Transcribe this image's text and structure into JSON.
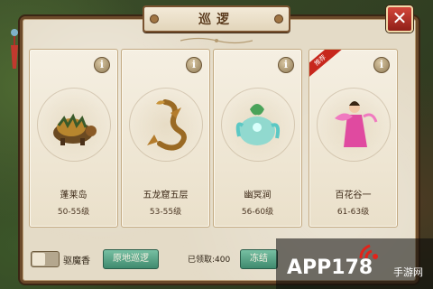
{
  "window": {
    "title": "巡逻",
    "close_label": "✕"
  },
  "cards": [
    {
      "name": "蓬莱岛",
      "level": "50-55级",
      "info_label": "i",
      "creature_icon": "turtle-beast-icon"
    },
    {
      "name": "五龙窟五层",
      "level": "53-55级",
      "info_label": "i",
      "creature_icon": "golden-dragon-icon"
    },
    {
      "name": "幽冥涧",
      "level": "56-60级",
      "info_label": "i",
      "creature_icon": "ghost-beast-icon"
    },
    {
      "name": "百花谷一",
      "level": "61-63级",
      "info_label": "i",
      "creature_icon": "flower-fairy-icon",
      "recommended": true,
      "ribbon_label": "推荐"
    }
  ],
  "bottom": {
    "toggle_label": "驱魔香",
    "patrol_button": "原地巡逻",
    "received": "已领取:400",
    "end_button": "冻结"
  },
  "watermark": {
    "brand": "APP178",
    "sub": "手游网"
  },
  "colors": {
    "accent_green": "#3f8a6e",
    "close_red": "#c7271c",
    "frame_brown": "#6c4a2a"
  }
}
